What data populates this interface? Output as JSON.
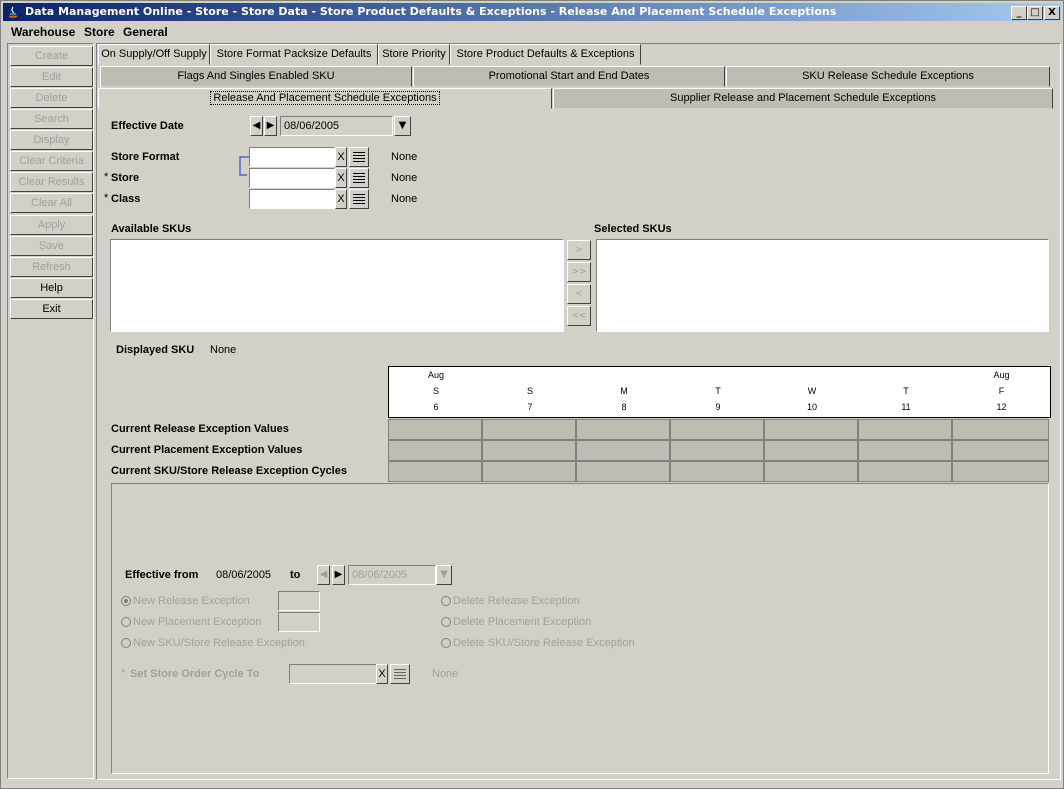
{
  "window": {
    "title": "Data Management Online - Store - Store Data - Store Product Defaults & Exceptions - Release And Placement Schedule Exceptions",
    "minimize": "_",
    "maximize": "□",
    "close": "X"
  },
  "menu": [
    "Warehouse",
    "Store",
    "General"
  ],
  "sidebar": [
    {
      "label": "Create",
      "enabled": false
    },
    {
      "label": "Edit",
      "enabled": false
    },
    {
      "label": "Delete",
      "enabled": false
    },
    {
      "label": "Search",
      "enabled": false
    },
    {
      "label": "Display",
      "enabled": false
    },
    {
      "label": "Clear Criteria",
      "enabled": false
    },
    {
      "label": "Clear Results",
      "enabled": false
    },
    {
      "label": "Clear All",
      "enabled": false
    },
    {
      "label": "Apply",
      "enabled": false
    },
    {
      "label": "Save",
      "enabled": false
    },
    {
      "label": "Refresh",
      "enabled": false
    },
    {
      "label": "Help",
      "enabled": true
    },
    {
      "label": "Exit",
      "enabled": true
    }
  ],
  "tabs_row1": [
    "On Supply/Off Supply",
    "Store Format Packsize Defaults",
    "Store Priority",
    "Store Product Defaults & Exceptions"
  ],
  "tabs_row2": [
    "Flags And Singles Enabled SKU",
    "Promotional Start and End Dates",
    "SKU Release Schedule Exceptions"
  ],
  "tabs_row3": [
    "Release And Placement Schedule Exceptions",
    "Supplier Release and Placement Schedule Exceptions"
  ],
  "form": {
    "effective_date_label": "Effective Date",
    "effective_date": "08/06/2005",
    "store_format_label": "Store Format",
    "store_label": "Store",
    "class_label": "Class",
    "required_mark": "*",
    "x": "X",
    "none": "None"
  },
  "skus": {
    "available_label": "Available SKUs",
    "selected_label": "Selected SKUs",
    "move_buttons": [
      ">",
      ">>",
      "<",
      "<<"
    ],
    "displayed_label": "Displayed SKU",
    "displayed_value": "None"
  },
  "calendar": {
    "columns": [
      {
        "month": "Aug",
        "dow": "S",
        "day": "6"
      },
      {
        "month": "",
        "dow": "S",
        "day": "7"
      },
      {
        "month": "",
        "dow": "M",
        "day": "8"
      },
      {
        "month": "",
        "dow": "T",
        "day": "9"
      },
      {
        "month": "",
        "dow": "W",
        "day": "10"
      },
      {
        "month": "",
        "dow": "T",
        "day": "11"
      },
      {
        "month": "Aug",
        "dow": "F",
        "day": "12"
      }
    ],
    "rows": [
      "Current Release Exception Values",
      "Current Placement Exception Values",
      "Current SKU/Store Release Exception Cycles"
    ]
  },
  "panel": {
    "effective_from_label": "Effective from",
    "effective_from": "08/06/2005",
    "to_label": "to",
    "to_date": "08/06/2005",
    "options_left": [
      "New Release Exception",
      "New Placement Exception",
      "New SKU/Store Release Exception"
    ],
    "options_right": [
      "Delete Release Exception",
      "Delete Placement Exception",
      "Delete SKU/Store Release Exception"
    ],
    "cycle_label": "Set Store Order Cycle To",
    "cycle_required": "*",
    "cycle_none": "None"
  }
}
